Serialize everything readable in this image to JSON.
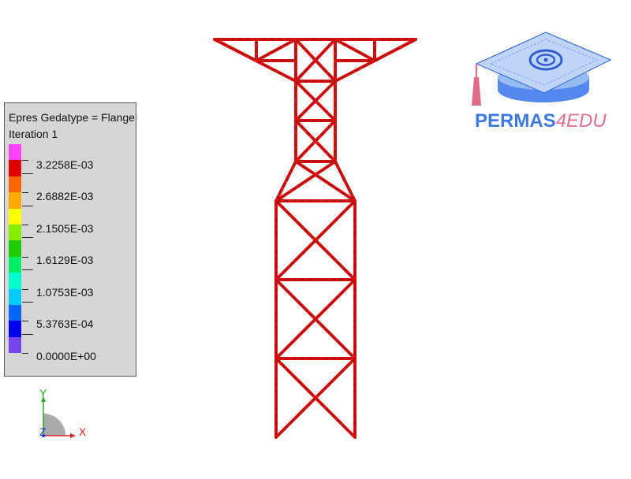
{
  "legend": {
    "title_line1": "Epres Gedatype = Flange",
    "title_line2": "Iteration 1",
    "colors": [
      "#ff44ff",
      "#e00000",
      "#ff6600",
      "#ffaa00",
      "#ffff00",
      "#88ee00",
      "#22cc00",
      "#00ee66",
      "#00ffcc",
      "#00ccff",
      "#0066ff",
      "#0000ee",
      "#7744ee"
    ],
    "values": [
      "3.2258E-03",
      "2.6882E-03",
      "2.1505E-03",
      "1.6129E-03",
      "1.0753E-03",
      "5.3763E-04",
      "0.0000E+00"
    ]
  },
  "axes": {
    "y_label": "Y",
    "z_label": "Z",
    "x_label": "X"
  },
  "logo": {
    "text_main": "PERMAS",
    "text_accent": "4EDU"
  },
  "model": {
    "member_color": "#dd1111",
    "member_outline": "#881111"
  }
}
